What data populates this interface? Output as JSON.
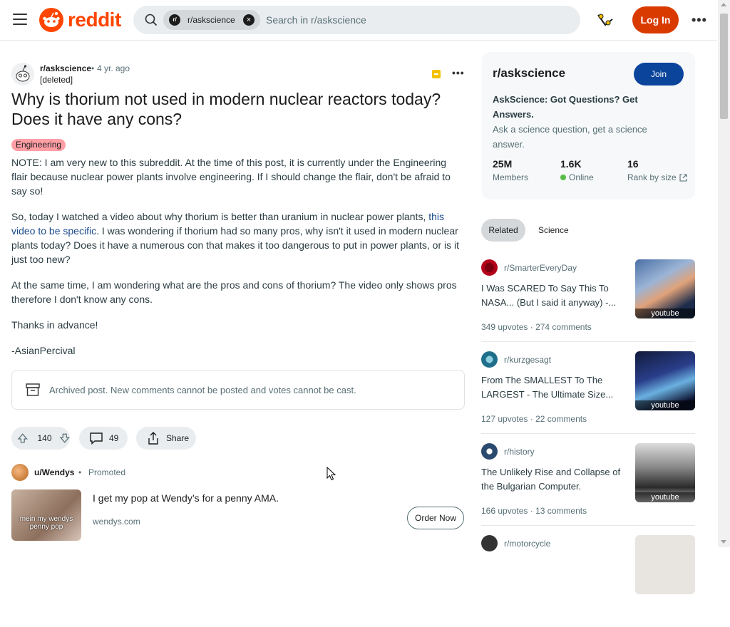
{
  "header": {
    "logo_text": "reddit",
    "search_chip_prefix": "r/",
    "search_chip": "r/askscience",
    "search_placeholder": "Search in r/askscience",
    "login_label": "Log In",
    "more_label": "•••"
  },
  "post": {
    "subreddit": "r/askscience",
    "dot": "•",
    "time": "4 yr. ago",
    "author": "[deleted]",
    "more_label": "•••",
    "title": "Why is thorium not used in modern nuclear reactors today? Does it have any cons?",
    "flair": "Engineering",
    "paragraphs": {
      "p1": "NOTE: I am very new to this subreddit. At the time of this post, it is currently under the Engineering flair because nuclear power plants involve engineering. If I should change the flair, don't be afraid to say so!",
      "p2_before": "So, today I watched a video about why thorium is better than uranium in nuclear power plants, ",
      "p2_link": "this video to be specific",
      "p2_after": ". I was wondering if thorium had so many pros, why isn't it used in modern nuclear plants today? Does it have a numerous con that makes it too dangerous to put in power plants, or is it just too new?",
      "p3": "At the same time, I am wondering what are the pros and cons of thorium? The video only shows pros therefore I don't know any cons.",
      "p4": "Thanks in advance!",
      "p5": "-AsianPercival"
    },
    "archived_notice": "Archived post. New comments cannot be posted and votes cannot be cast.",
    "upvotes": "140",
    "comments": "49",
    "share_label": "Share"
  },
  "ad": {
    "advertiser": "u/Wendys",
    "dot": "•",
    "promoted_label": "Promoted",
    "thumb_caption": "mein my wendys penny pop",
    "headline": "I get my pop at Wendy’s for a penny AMA.",
    "domain": "wendys.com",
    "cta": "Order Now"
  },
  "sidebar": {
    "name": "r/askscience",
    "join_label": "Join",
    "title": "AskScience: Got Questions? Get Answers.",
    "description": "Ask a science question, get a science answer.",
    "stats": {
      "members_value": "25M",
      "members_label": "Members",
      "online_value": "1.6K",
      "online_label": "Online",
      "rank_value": "16",
      "rank_label": "Rank by size"
    }
  },
  "related_tabs": [
    "Related",
    "Science"
  ],
  "related": [
    {
      "subreddit": "r/SmarterEveryDay",
      "title": "I Was SCARED To Say This To NASA... (But I said it anyway) -...",
      "upvotes": "349 upvotes",
      "dot": "·",
      "comments": "274 comments",
      "thumb_label": "youtube",
      "avatar_color": "#b3001b"
    },
    {
      "subreddit": "r/kurzgesagt",
      "title": "From The SMALLEST To The LARGEST - The Ultimate Size...",
      "upvotes": "127 upvotes",
      "dot": "·",
      "comments": "22 comments",
      "thumb_label": "youtube",
      "avatar_color": "#1f6f8b"
    },
    {
      "subreddit": "r/history",
      "title": "The Unlikely Rise and Collapse of the Bulgarian Computer.",
      "upvotes": "166 upvotes",
      "dot": "·",
      "comments": "13 comments",
      "thumb_label": "youtube",
      "avatar_color": "#2b4a6f"
    },
    {
      "subreddit": "r/motorcycle",
      "avatar_color": "#333333"
    }
  ],
  "colors": {
    "brand": "#ff4500",
    "login": "#d93a00",
    "join": "#0a449b",
    "flair": "#ff9fa5",
    "online": "#55bd46"
  }
}
